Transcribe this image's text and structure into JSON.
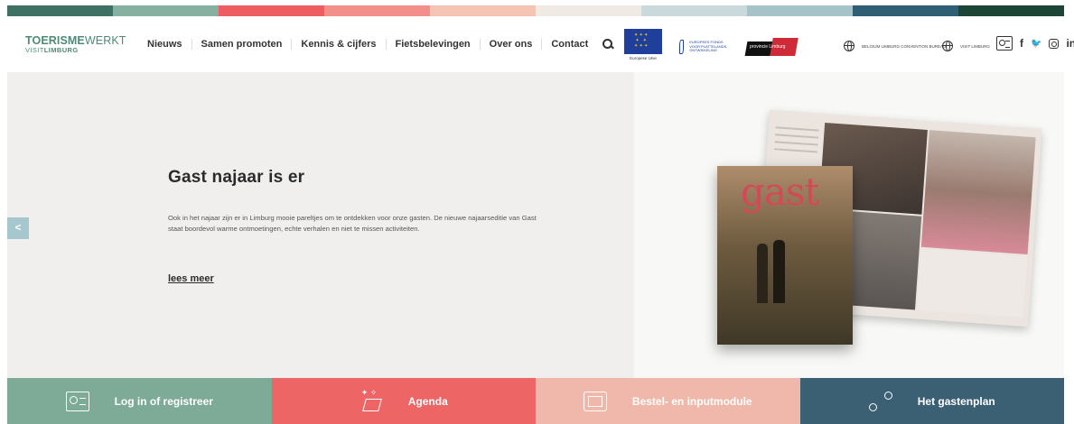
{
  "colors": {
    "strip": [
      "#3e7163",
      "#86b0a0",
      "#ee5d61",
      "#f28f8a",
      "#f5c4b4",
      "#efebe4",
      "#c9d9dc",
      "#a5c3c8",
      "#2f5f75",
      "#1d4536"
    ],
    "tile_login": "#7eab98",
    "tile_agenda": "#ee6565",
    "tile_order": "#f0b8aa",
    "tile_plan": "#3b6073",
    "hero_bg": "#f1efee",
    "prev_button": "#a7c7cf"
  },
  "logo": {
    "line1_bold": "TOERISME",
    "line1_light": "WERKT",
    "line2_light": "VISIT",
    "line2_bold": "LIMBURG"
  },
  "nav": {
    "items": [
      {
        "label": "Nieuws"
      },
      {
        "label": "Samen promoten"
      },
      {
        "label": "Kennis & cijfers"
      },
      {
        "label": "Fietsbelevingen"
      },
      {
        "label": "Over ons"
      },
      {
        "label": "Contact"
      }
    ],
    "search_icon": "search-icon"
  },
  "partners": {
    "eu_caption": "Europese Unie",
    "plattelands_text": "EUROPEES FONDS VOOR PLATTELANDS-ONTWIKKELING",
    "provincie_text": "provincie Limburg",
    "ext1_text": "BELGIUM LIMBURG CONVENTION BUREAU",
    "ext2_text": "VISIT LIMBURG"
  },
  "social": {
    "facebook": "f",
    "twitter": "🐦",
    "linkedin": "in"
  },
  "hero": {
    "prev_label": "<",
    "title": "Gast najaar is er",
    "body": "Ook in het najaar zijn er in Limburg mooie pareltjes om te ontdekken voor onze gasten. De nieuwe najaarseditie van Gast staat boordevol warme ontmoetingen, echte verhalen en niet te missen activiteiten.",
    "link": "lees meer",
    "magazine_title": "gast"
  },
  "tiles": [
    {
      "label": "Log in of registreer",
      "icon": "id-card-icon"
    },
    {
      "label": "Agenda",
      "icon": "sparkle-pen-icon"
    },
    {
      "label": "Bestel- en inputmodule",
      "icon": "box-icon"
    },
    {
      "label": "Het gastenplan",
      "icon": "route-icon"
    }
  ]
}
